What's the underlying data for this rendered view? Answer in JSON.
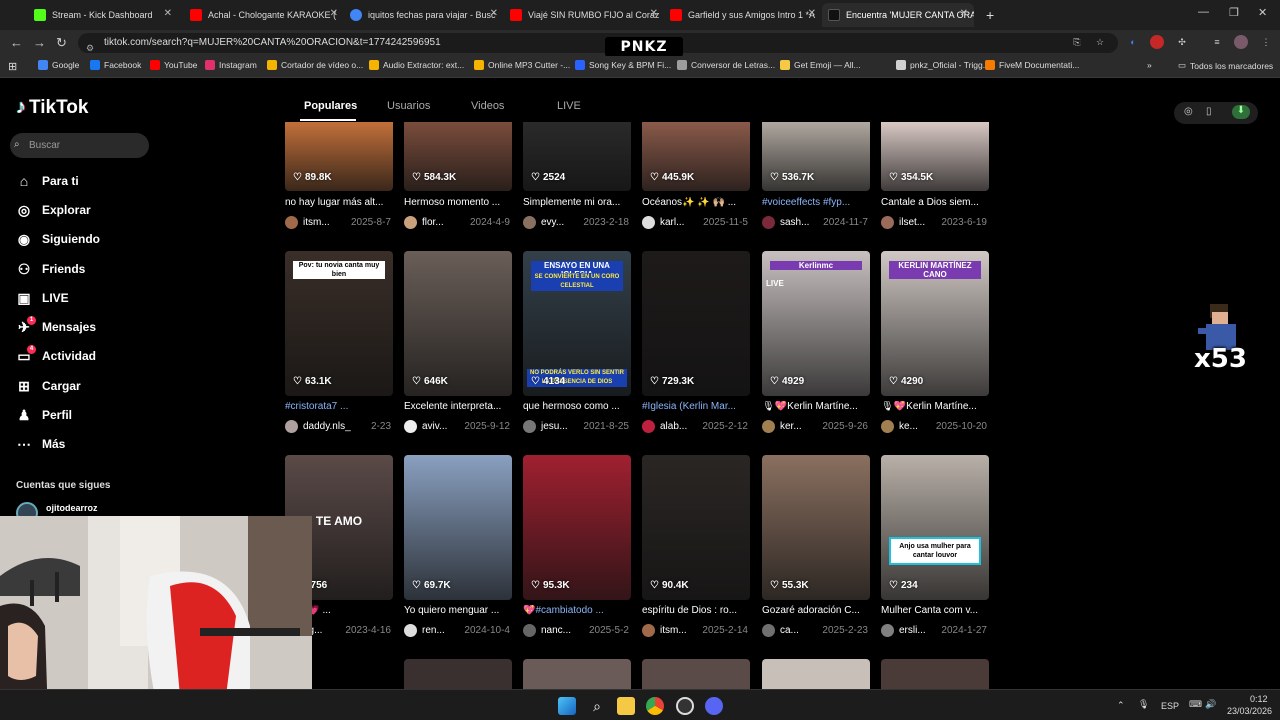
{
  "browser": {
    "tabs": [
      {
        "title": "Stream - Kick Dashboard",
        "color": "#53fc18"
      },
      {
        "title": "Achal - Chologante KARAOKE (",
        "color": "#ff0000"
      },
      {
        "title": "iquitos fechas para viajar - Busc",
        "color": "#4285f4"
      },
      {
        "title": "Viajé SIN RUMBO FIJO al Coraz",
        "color": "#ff0000"
      },
      {
        "title": "Garfield y sus Amigos Intro 1 *A",
        "color": "#ff0000"
      },
      {
        "title": "Encuentra 'MUJER CANTA ORA",
        "color": "#111111"
      }
    ],
    "new_tab": "+",
    "url": "tiktok.com/search?q=MUJER%20CANTA%20ORACION&t=1774242596951",
    "bookmarks": [
      {
        "label": "Google",
        "color": "#4285f4"
      },
      {
        "label": "Facebook",
        "color": "#1877f2"
      },
      {
        "label": "YouTube",
        "color": "#ff0000"
      },
      {
        "label": "Instagram",
        "color": "#e1306c"
      },
      {
        "label": "Cortador de vídeo o...",
        "color": "#f4b400"
      },
      {
        "label": "Audio Extractor: ext...",
        "color": "#f4b400"
      },
      {
        "label": "Online MP3 Cutter -...",
        "color": "#f4b400"
      },
      {
        "label": "Song Key & BPM Fi...",
        "color": "#2962ff"
      },
      {
        "label": "Conversor de Letras...",
        "color": "#9e9e9e"
      },
      {
        "label": "Get Emoji — All...",
        "color": "#f6c945"
      },
      {
        "label": "pnkz_Oficial - Trigg...",
        "color": "#d0d0d0"
      },
      {
        "label": "FiveM Documentati...",
        "color": "#f57c00"
      }
    ],
    "all_bookmarks": "Todos los marcadores",
    "pnkz_logo": "PNKZ"
  },
  "tiktok": {
    "logo": "TikTok",
    "search_placeholder": "Buscar",
    "nav": [
      {
        "label": "Para ti",
        "icon": "home-icon",
        "glyph": "⌂"
      },
      {
        "label": "Explorar",
        "icon": "compass-icon",
        "glyph": "◎"
      },
      {
        "label": "Siguiendo",
        "icon": "following-icon",
        "glyph": "◉"
      },
      {
        "label": "Friends",
        "icon": "friends-icon",
        "glyph": "⚇"
      },
      {
        "label": "LIVE",
        "icon": "live-icon",
        "glyph": "▣"
      },
      {
        "label": "Mensajes",
        "icon": "messages-icon",
        "glyph": "✈",
        "badge": "1"
      },
      {
        "label": "Actividad",
        "icon": "activity-icon",
        "glyph": "▭",
        "badge": "4"
      },
      {
        "label": "Cargar",
        "icon": "upload-icon",
        "glyph": "⊞"
      },
      {
        "label": "Perfil",
        "icon": "profile-icon",
        "glyph": "♟"
      },
      {
        "label": "Más",
        "icon": "more-icon",
        "glyph": "⋯"
      }
    ],
    "following_heading": "Cuentas que sigues",
    "following_user": "ojitodearroz",
    "tabs": [
      "Populares",
      "Usuarios",
      "Videos",
      "LIVE"
    ],
    "videos": [
      {
        "likes": "89.8K",
        "title": "no hay lugar más alt...",
        "user": "itsm...",
        "date": "2025-8-7",
        "bg": "#c2703a",
        "av": "#a06a4a"
      },
      {
        "likes": "584.3K",
        "title": "Hermoso momento ...",
        "user": "flor...",
        "date": "2024-4-9",
        "bg": "#7a4d3c",
        "av": "#c9a27d"
      },
      {
        "likes": "2524",
        "title": "Simplemente mi ora...",
        "user": "evy...",
        "date": "2023-2-18",
        "bg": "#2a2a2a",
        "av": "#8a7060"
      },
      {
        "likes": "445.9K",
        "title": "Océanos✨ ✨ 🙌🏼 ...",
        "user": "karl...",
        "date": "2025-11-5",
        "bg": "#8a5a4a",
        "av": "#dddddd"
      },
      {
        "likes": "536.7K",
        "title": "#voiceeffects #fyp...",
        "title_hl": true,
        "user": "sash...",
        "date": "2024-11-7",
        "bg": "#b0a8a0",
        "av": "#7a2a3a"
      },
      {
        "likes": "354.5K",
        "title": "Cantale a Dios siem...",
        "user": "ilset...",
        "date": "2023-6-19",
        "bg": "#d8c8c4",
        "av": "#9a6a5a"
      },
      {
        "likes": "63.1K",
        "title": "#cristorata7 ...",
        "title_hl": true,
        "user": "daddy.nls_",
        "date": "2-23",
        "bg": "#3a2e28",
        "av": "#b0a0a0",
        "overlay": "Pov: tu novia canta muy bien"
      },
      {
        "likes": "646K",
        "title": "Excelente interpreta...",
        "user": "aviv...",
        "date": "2025-9-12",
        "bg": "#6a5e58",
        "av": "#eeeeee"
      },
      {
        "likes": "4134",
        "title": "que hermoso como ...",
        "user": "jesu...",
        "date": "2021-8-25",
        "bg": "#33404a",
        "av": "#777777",
        "overlay": "ENSAYO EN UNA IGLESIA",
        "overlay2": "SE CONVIERTE EN UN CORO CELESTIAL",
        "overlay3": "NO PODRÁS VERLO SIN SENTIR LA PRESENCIA DE DIOS"
      },
      {
        "likes": "729.3K",
        "title": "#Iglesia (Kerlin Mar...",
        "title_hl": true,
        "user": "alab...",
        "date": "2025-2-12",
        "bg": "#1e1a1a",
        "av": "#c02040"
      },
      {
        "likes": "4929",
        "title": "🎙💖Kerlin Martíne...",
        "user": "ker...",
        "date": "2025-9-26",
        "bg": "#c8c0c0",
        "av": "#a08050",
        "overlay": "Kerlinmc",
        "live": "LIVE"
      },
      {
        "likes": "4290",
        "title": "🎙💖Kerlin Martíne...",
        "user": "ke...",
        "date": "2025-10-20",
        "bg": "#d0c8c4",
        "av": "#a08050",
        "overlay": "KERLIN MARTÍNEZ CANO"
      },
      {
        "likes": "5756",
        "title": "amo 💗 ...",
        "user": "ng...",
        "date": "2023-4-16",
        "bg": "#5a4a48",
        "av": "#888888",
        "overlay": "TE AMO"
      },
      {
        "likes": "69.7K",
        "title": "Yo quiero menguar ...",
        "user": "ren...",
        "date": "2024-10-4",
        "bg": "#8aa0c0",
        "av": "#dddddd"
      },
      {
        "likes": "95.3K",
        "title": "💖#cambiatodo ...",
        "title_hl": true,
        "user": "nanc...",
        "date": "2025-5-2",
        "bg": "#a02030",
        "av": "#666666"
      },
      {
        "likes": "90.4K",
        "title": "espíritu de Dios : ro...",
        "user": "itsm...",
        "date": "2025-2-14",
        "bg": "#2a2624",
        "av": "#a06a4a"
      },
      {
        "likes": "55.3K",
        "title": "Gozaré adoración C...",
        "user": "ca...",
        "date": "2025-2-23",
        "bg": "#8a7060",
        "av": "#707070"
      },
      {
        "likes": "234",
        "title": "Mulher Canta com v...",
        "user": "ersli...",
        "date": "2024-1-27",
        "bg": "#b8b0a8",
        "av": "#808080",
        "overlay": "Anjo usa mulher para cantar louvor"
      }
    ],
    "right_icons": [
      "nav-icon",
      "mobile-icon",
      "download-icon"
    ]
  },
  "stream_overlay": {
    "combo": "x53"
  },
  "taskbar": {
    "lang": "ESP",
    "time": "0:12",
    "date": "23/03/2026"
  }
}
